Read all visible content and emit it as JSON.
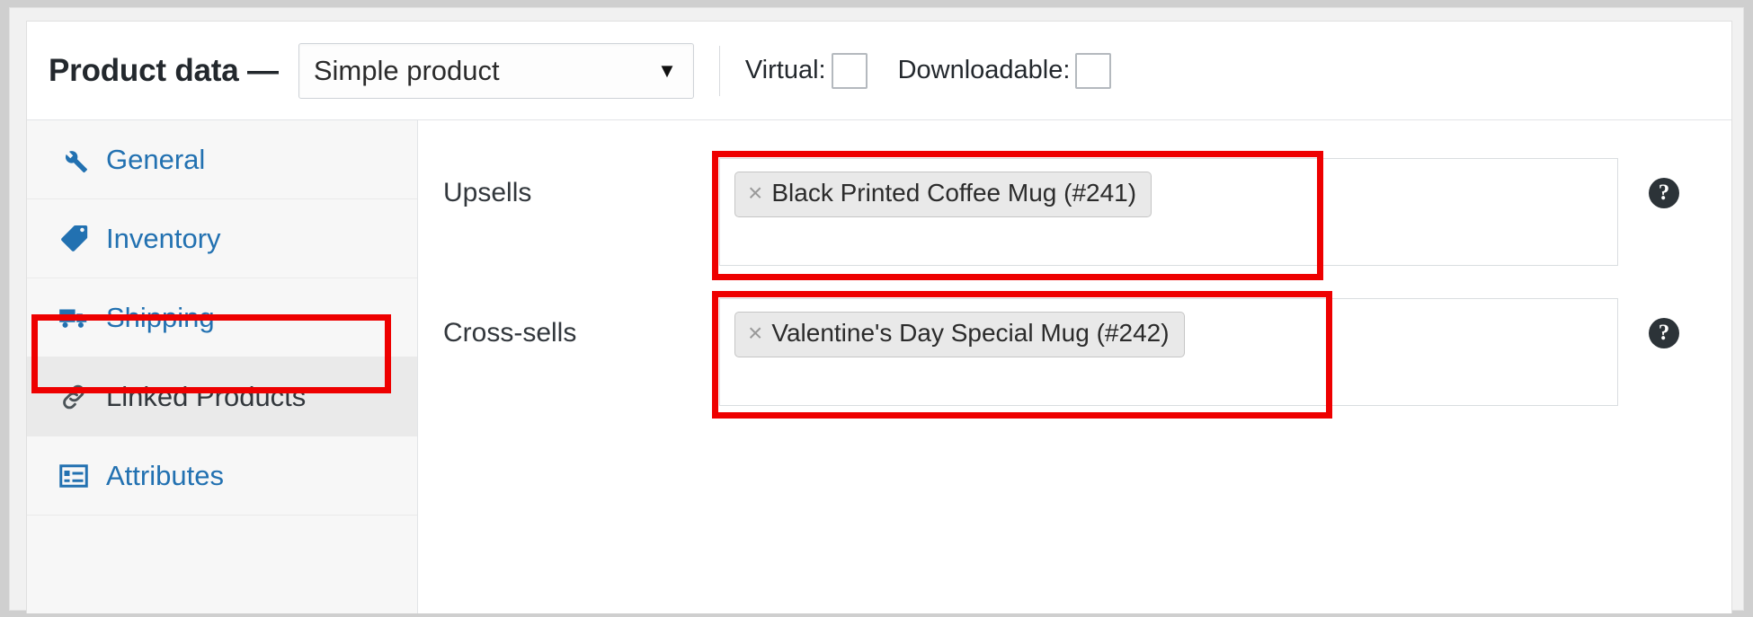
{
  "header": {
    "title": "Product data —",
    "product_type": {
      "selected": "Simple product",
      "caret_icon": "chevron-down-icon"
    },
    "virtual": {
      "label": "Virtual:",
      "checked": false
    },
    "downloadable": {
      "label": "Downloadable:",
      "checked": false
    }
  },
  "tabs": [
    {
      "label": "General",
      "icon": "wrench-icon",
      "active": false
    },
    {
      "label": "Inventory",
      "icon": "tag-icon",
      "active": false
    },
    {
      "label": "Shipping",
      "icon": "truck-icon",
      "active": false
    },
    {
      "label": "Linked Products",
      "icon": "link-chain-icon",
      "active": true
    },
    {
      "label": "Attributes",
      "icon": "list-view-icon",
      "active": false
    }
  ],
  "fields": [
    {
      "label": "Upsells",
      "tokens": [
        {
          "remove_icon": "×",
          "text": "Black Printed Coffee Mug (#241)"
        }
      ],
      "help_icon": "help-circle-icon",
      "highlighted": true
    },
    {
      "label": "Cross-sells",
      "tokens": [
        {
          "remove_icon": "×",
          "text": "Valentine's Day Special Mug (#242)"
        }
      ],
      "help_icon": "help-circle-icon",
      "highlighted": true
    }
  ],
  "colors": {
    "annotation_red": "#ee0000",
    "link_blue": "#2271b1",
    "icon_blue": "#2271b1",
    "panel_bg": "#ffffff",
    "sidebar_bg": "#f7f7f7",
    "active_tab_bg": "#eaeaea"
  }
}
